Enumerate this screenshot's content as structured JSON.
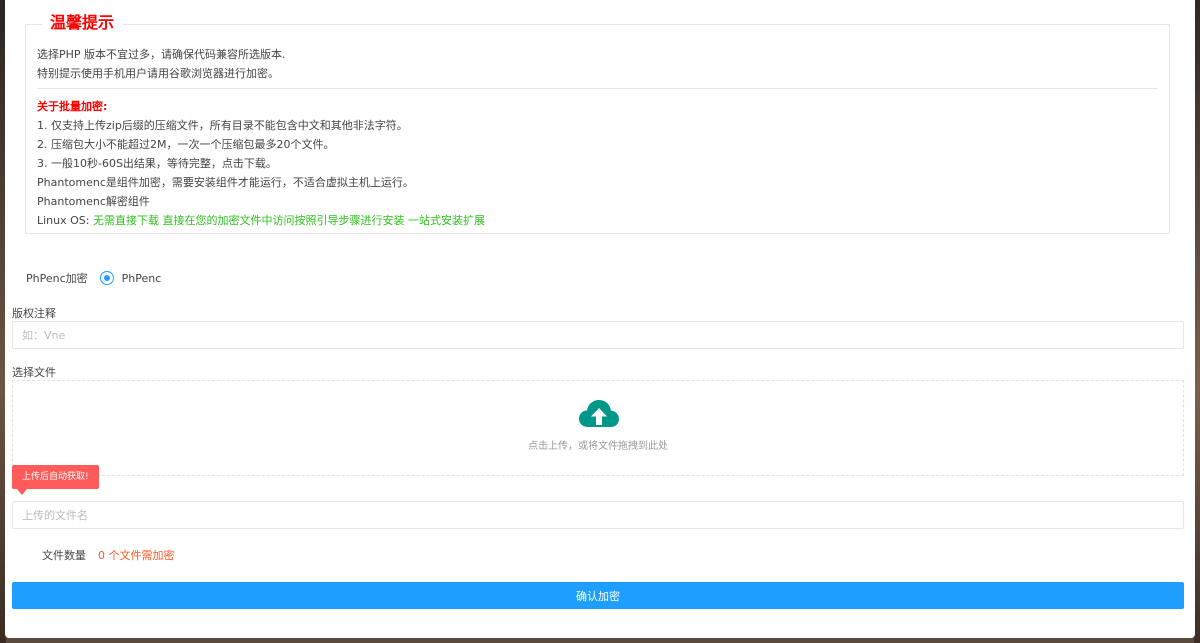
{
  "notice": {
    "title": "温馨提示",
    "lines_top": [
      "选择PHP 版本不宜过多，请确保代码兼容所选版本.",
      "特别提示使用手机用户请用谷歌浏览器进行加密。"
    ],
    "batch_heading": "关于批量加密:",
    "batch_lines": [
      "1. 仅支持上传zip后缀的压缩文件，所有目录不能包含中文和其他非法字符。",
      "2. 压缩包大小不能超过2M，一次一个压缩包最多20个文件。",
      "3. 一般10秒-60S出结果，等待完整，点击下载。",
      "Phantomenc是组件加密，需要安装组件才能运行，不适合虚拟主机上运行。",
      "Phantomenc解密组件"
    ],
    "linux_prefix": "Linux OS: ",
    "linux_links": "无需直接下载 直接在您的加密文件中访问按照引导步骤进行安装 一站式安装扩展"
  },
  "encryption": {
    "label": "PhPenc加密",
    "option": "PhPenc",
    "selected": true
  },
  "copyright": {
    "label": "版权注释",
    "placeholder": "如：Vne",
    "value": ""
  },
  "upload": {
    "label": "选择文件",
    "hint": "点击上传，或将文件拖拽到此处",
    "icon": "cloud-upload-icon",
    "icon_color": "#009688"
  },
  "badge": {
    "text": "上传后自动获取!"
  },
  "filename": {
    "placeholder": "上传的文件名",
    "value": ""
  },
  "file_count": {
    "label": "文件数量",
    "value": "0 个文件需加密"
  },
  "submit": {
    "label": "确认加密"
  },
  "colors": {
    "primary": "#1e9fff",
    "notice_title": "#ff0000",
    "linux_links": "#2fc11d",
    "count": "#ff5722",
    "badge": "#ff5b5b"
  }
}
